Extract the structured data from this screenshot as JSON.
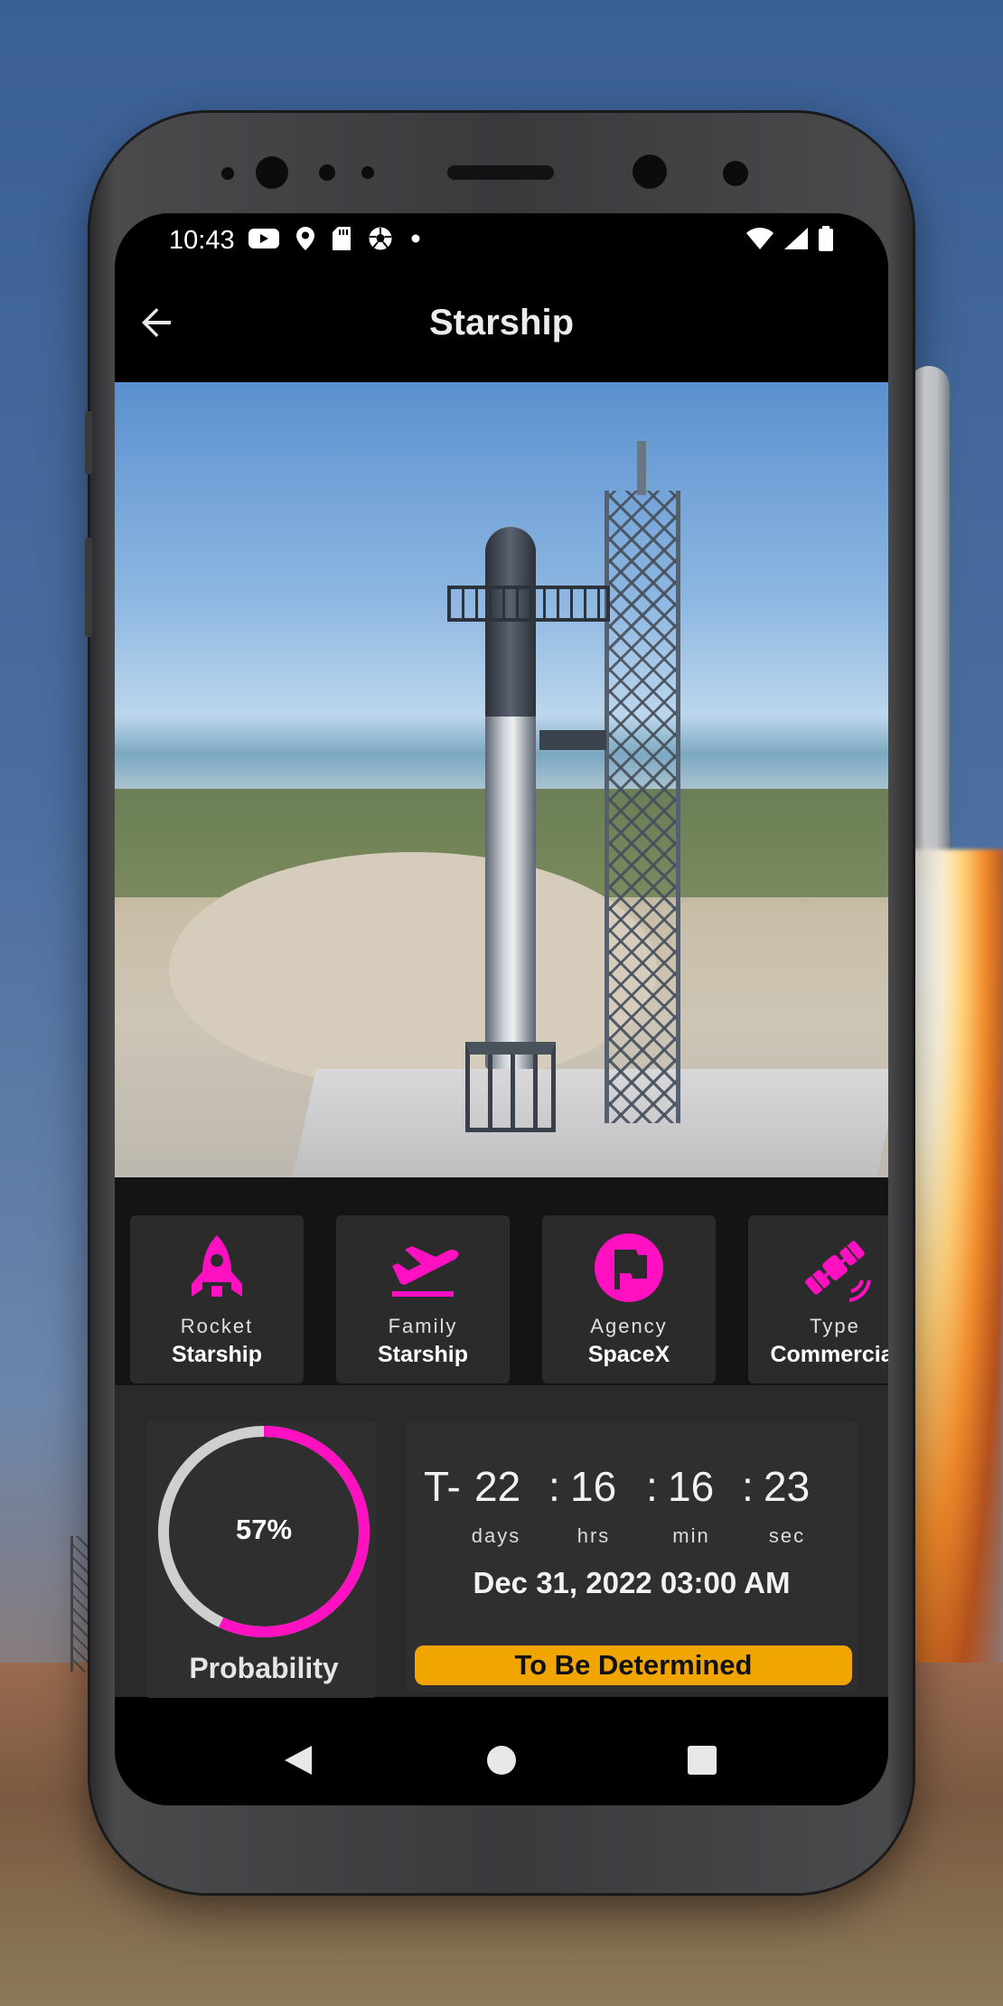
{
  "status_bar": {
    "time": "10:43",
    "left_icons": [
      "youtube-icon",
      "location-icon",
      "sd-card-icon",
      "soccer-ball-icon",
      "dot-icon"
    ],
    "right_icons": [
      "wifi-icon",
      "signal-icon",
      "battery-icon"
    ]
  },
  "app_bar": {
    "title": "Starship",
    "back_icon": "arrow-back-icon"
  },
  "info_cards": [
    {
      "label": "Rocket",
      "value": "Starship",
      "icon": "rocket-icon"
    },
    {
      "label": "Family",
      "value": "Starship",
      "icon": "takeoff-icon"
    },
    {
      "label": "Agency",
      "value": "SpaceX",
      "icon": "flag-circle-icon"
    },
    {
      "label": "Type",
      "value": "Commercial",
      "icon": "satellite-icon"
    }
  ],
  "probability": {
    "value": 57,
    "text": "57%",
    "label": "Probability"
  },
  "countdown": {
    "prefix": "T-",
    "days": "22",
    "hours": "16",
    "minutes": "16",
    "seconds": "23",
    "separator": ":",
    "units": {
      "days": "days",
      "hours": "hrs",
      "minutes": "min",
      "seconds": "sec"
    },
    "date": "Dec 31, 2022 03:00 AM",
    "status": "To Be Determined"
  },
  "nav": {
    "back": "nav-back-icon",
    "home": "nav-home-icon",
    "recents": "nav-recents-icon"
  },
  "colors": {
    "accent": "#ff10c0",
    "status_pill": "#f0a500",
    "ring_track": "#cfcfcf",
    "card_bg": "#2b2b2c"
  }
}
